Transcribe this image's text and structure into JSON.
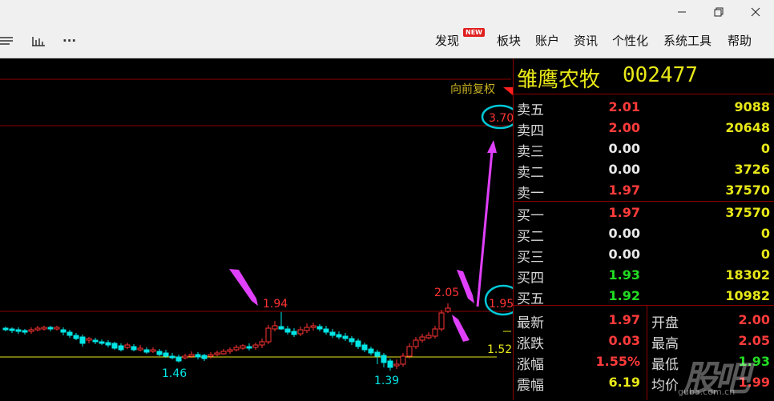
{
  "window": {
    "minimize_icon": "minimize-icon",
    "restore_icon": "restore-icon",
    "close_icon": "close-icon"
  },
  "toolbar": {
    "icons": [
      "list-icon",
      "bar-chart-icon",
      "more-icon"
    ],
    "more_label": "···"
  },
  "menu": {
    "items": [
      "发现",
      "板块",
      "账户",
      "资讯",
      "个性化",
      "系统工具",
      "帮助"
    ],
    "new_badge": "NEW"
  },
  "chart": {
    "adjust_label": "向前复权",
    "price_levels": {
      "top": "3.70",
      "current": "1.95",
      "right_low": "1.52"
    },
    "annotations": {
      "high_left": "1.94",
      "high_right": "2.05",
      "low_left": "1.46",
      "low_right": "1.39"
    },
    "colors": {
      "up": "#ff3333",
      "down": "#00e5e5",
      "arrow": "#e040fb",
      "circle": "#00c8d8",
      "grid": "#8b0000",
      "ma": "#e8e818"
    }
  },
  "quote": {
    "name": "雏鹰农牧",
    "code": "002477",
    "asks": [
      {
        "label": "卖五",
        "price": "2.01",
        "vol": "9088",
        "color": "#ff3b3b"
      },
      {
        "label": "卖四",
        "price": "2.00",
        "vol": "20648",
        "color": "#ff3b3b"
      },
      {
        "label": "卖三",
        "price": "0.00",
        "vol": "0",
        "color": "#e8e8e8"
      },
      {
        "label": "卖二",
        "price": "0.00",
        "vol": "3726",
        "color": "#e8e8e8"
      },
      {
        "label": "卖一",
        "price": "1.97",
        "vol": "37570",
        "color": "#ff3b3b"
      }
    ],
    "bids": [
      {
        "label": "买一",
        "price": "1.97",
        "vol": "37570",
        "color": "#ff3b3b"
      },
      {
        "label": "买二",
        "price": "0.00",
        "vol": "0",
        "color": "#e8e8e8"
      },
      {
        "label": "买三",
        "price": "0.00",
        "vol": "0",
        "color": "#e8e8e8"
      },
      {
        "label": "买四",
        "price": "1.93",
        "vol": "18302",
        "color": "#22dd22"
      },
      {
        "label": "买五",
        "price": "1.92",
        "vol": "10982",
        "color": "#22dd22"
      }
    ],
    "stats": {
      "latest_label": "最新",
      "latest": "1.97",
      "change_label": "涨跌",
      "change": "0.03",
      "pct_label": "涨幅",
      "pct": "1.55%",
      "amp_label": "震幅",
      "amp": "6.19",
      "open_label": "开盘",
      "open": "2.00",
      "high_label": "最高",
      "high": "2.05",
      "low_label": "最低",
      "low": "1.93",
      "avg_label": "均价",
      "avg": "1.99"
    }
  },
  "watermark": {
    "text": "股吧",
    "url": "guba.com.cn"
  }
}
